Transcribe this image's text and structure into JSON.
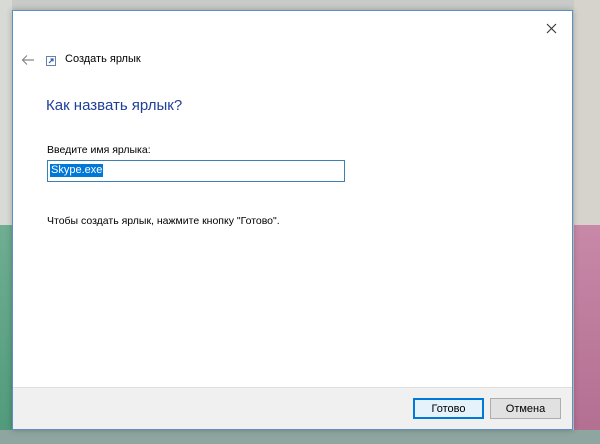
{
  "wizard": {
    "title": "Создать ярлык",
    "heading": "Как назвать ярлык?",
    "field_label": "Введите имя ярлыка:",
    "name_value": "Skype.exe",
    "hint": "Чтобы создать ярлык, нажмите кнопку \"Готово\"."
  },
  "buttons": {
    "finish_label": "Готово",
    "cancel_label": "Отмена"
  },
  "icons": {
    "close": "close-icon",
    "back": "back-arrow-icon",
    "wizard": "shortcut-icon"
  },
  "colors": {
    "heading": "#1f3f9a",
    "accent": "#0078d7",
    "window_border": "#5b8fc6"
  }
}
